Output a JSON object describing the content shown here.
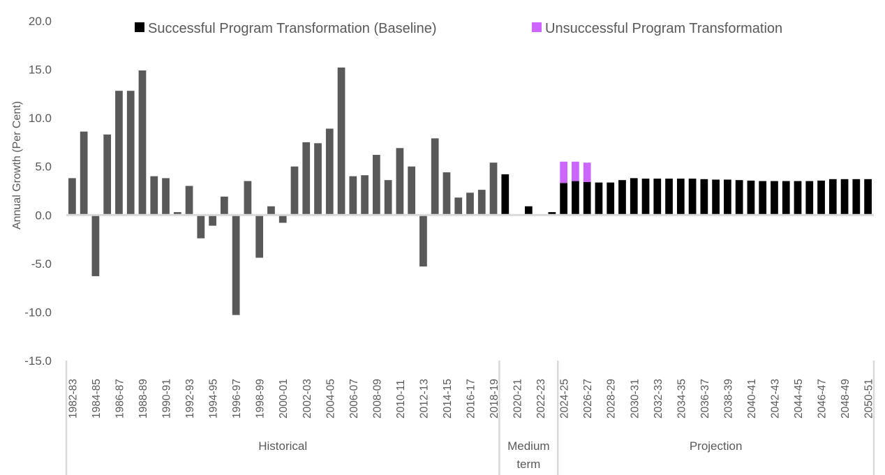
{
  "chart_data": {
    "type": "bar",
    "stacked": true,
    "title": "",
    "xlabel": "",
    "ylabel": "Annual Growth (Per Cent)",
    "ylim": [
      -15,
      20
    ],
    "yticks": [
      "20.0",
      "15.0",
      "10.0",
      "5.0",
      "0.0",
      "-5.0",
      "-10.0",
      "-15.0"
    ],
    "ytick_values": [
      20,
      15,
      10,
      5,
      0,
      -5,
      -10,
      -15
    ],
    "grid": false,
    "legend_position": "top",
    "legend": [
      {
        "label": "Successful Program Transformation (Baseline)",
        "color": "#000000",
        "series": "baseline"
      },
      {
        "label": "Unsuccessful Program Transformation",
        "color": "#cc66ff",
        "series": "unsuccessful"
      }
    ],
    "colors": {
      "historical": "#595959",
      "baseline": "#000000",
      "unsuccessful": "#cc66ff",
      "axis": "#d9d9d9"
    },
    "categories": [
      "1982-83",
      "1983-84",
      "1984-85",
      "1985-86",
      "1986-87",
      "1987-88",
      "1988-89",
      "1989-90",
      "1990-91",
      "1991-92",
      "1992-93",
      "1993-94",
      "1994-95",
      "1995-96",
      "1996-97",
      "1997-98",
      "1998-99",
      "1999-00",
      "2000-01",
      "2001-02",
      "2002-03",
      "2003-04",
      "2004-05",
      "2005-06",
      "2006-07",
      "2007-08",
      "2008-09",
      "2009-10",
      "2010-11",
      "2011-12",
      "2012-13",
      "2013-14",
      "2014-15",
      "2015-16",
      "2016-17",
      "2017-18",
      "2018-19",
      "2019-20",
      "2020-21",
      "2021-22",
      "2022-23",
      "2023-24",
      "2024-25",
      "2025-26",
      "2026-27",
      "2027-28",
      "2028-29",
      "2029-30",
      "2030-31",
      "2031-32",
      "2032-33",
      "2033-34",
      "2034-35",
      "2035-36",
      "2036-37",
      "2037-38",
      "2038-39",
      "2039-40",
      "2040-41",
      "2041-42",
      "2042-43",
      "2043-44",
      "2044-45",
      "2045-46",
      "2046-47",
      "2047-48",
      "2048-49",
      "2049-50",
      "2050-51"
    ],
    "label_every": 2,
    "groups": [
      {
        "label": "Historical",
        "start": "1982-83",
        "end": "2018-19"
      },
      {
        "label": "Medium term",
        "label_lines": [
          "Medium",
          "term"
        ],
        "start": "2019-20",
        "end": "2023-24"
      },
      {
        "label": "Projection",
        "start": "2024-25",
        "end": "2050-51"
      }
    ],
    "series": [
      {
        "name": "Historical",
        "color": "#595959",
        "values": [
          3.8,
          8.6,
          -6.3,
          8.3,
          12.8,
          12.8,
          14.9,
          4.0,
          3.8,
          0.3,
          3.0,
          -2.4,
          -1.1,
          1.9,
          -10.3,
          3.5,
          -4.4,
          0.9,
          -0.8,
          5.0,
          7.5,
          7.4,
          8.9,
          15.2,
          4.0,
          4.1,
          6.2,
          3.6,
          6.9,
          5.0,
          -5.3,
          7.9,
          4.4,
          1.8,
          2.3,
          2.6,
          5.4,
          null,
          null,
          null,
          null,
          null,
          null,
          null,
          null,
          null,
          null,
          null,
          null,
          null,
          null,
          null,
          null,
          null,
          null,
          null,
          null,
          null,
          null,
          null,
          null,
          null,
          null,
          null,
          null,
          null,
          null,
          null,
          null
        ]
      },
      {
        "name": "Successful Program Transformation (Baseline)",
        "color": "#000000",
        "values": [
          null,
          null,
          null,
          null,
          null,
          null,
          null,
          null,
          null,
          null,
          null,
          null,
          null,
          null,
          null,
          null,
          null,
          null,
          null,
          null,
          null,
          null,
          null,
          null,
          null,
          null,
          null,
          null,
          null,
          null,
          null,
          null,
          null,
          null,
          null,
          null,
          null,
          4.2,
          0.05,
          0.9,
          0.0,
          0.3,
          3.3,
          3.5,
          3.4,
          3.35,
          3.35,
          3.6,
          3.8,
          3.75,
          3.75,
          3.75,
          3.75,
          3.75,
          3.7,
          3.65,
          3.65,
          3.6,
          3.55,
          3.5,
          3.5,
          3.5,
          3.5,
          3.5,
          3.55,
          3.7,
          3.7,
          3.7,
          3.7
        ]
      },
      {
        "name": "Unsuccessful Program Transformation",
        "color": "#cc66ff",
        "values": [
          null,
          null,
          null,
          null,
          null,
          null,
          null,
          null,
          null,
          null,
          null,
          null,
          null,
          null,
          null,
          null,
          null,
          null,
          null,
          null,
          null,
          null,
          null,
          null,
          null,
          null,
          null,
          null,
          null,
          null,
          null,
          null,
          null,
          null,
          null,
          null,
          null,
          null,
          null,
          null,
          null,
          null,
          2.2,
          2.0,
          2.0,
          null,
          null,
          null,
          null,
          null,
          null,
          null,
          null,
          null,
          null,
          null,
          null,
          null,
          null,
          null,
          null,
          null,
          null,
          null,
          null,
          null,
          null,
          null,
          null
        ]
      }
    ]
  }
}
